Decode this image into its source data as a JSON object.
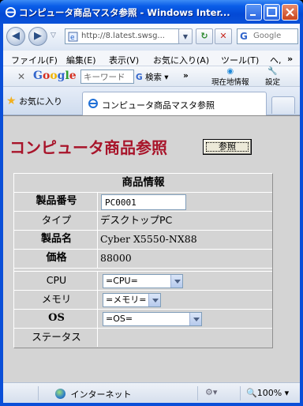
{
  "window": {
    "title": "コンピュータ商品マスタ参照 - Windows Inter..."
  },
  "address_bar": {
    "url": "http://8.latest.swsg...",
    "search_placeholder": "Google"
  },
  "menu": {
    "items": [
      "ファイル(F)",
      "編集(E)",
      "表示(V)",
      "お気に入り(A)",
      "ツール(T)",
      "ヘ,"
    ]
  },
  "google_toolbar": {
    "logo": "Google",
    "keyword_placeholder": "キーワード",
    "search_label": "検索",
    "location_label": "現在地情報",
    "settings_label": "設定"
  },
  "favorites": {
    "label": "お気に入り",
    "tab_title": "コンピュータ商品マスタ参照"
  },
  "page": {
    "title": "コンピュータ商品参照",
    "ref_button": "参照",
    "section_title": "商品情報",
    "fields": {
      "product_no_label": "製品番号",
      "product_no_value": "PC0001",
      "type_label": "タイプ",
      "type_value": "デスクトップPC",
      "name_label": "製品名",
      "name_value": "Cyber X5550-NX88",
      "price_label": "価格",
      "price_value": "88000",
      "cpu_label": "CPU",
      "cpu_value": "=CPU=",
      "memory_label": "メモリ",
      "memory_value": "=メモリ=",
      "os_label": "OS",
      "os_value": "=OS=",
      "status_label": "ステータス",
      "status_value": ""
    }
  },
  "status_bar": {
    "zone": "インターネット",
    "zoom": "100%"
  },
  "colors": {
    "title_red": "#a8142a",
    "xp_blue": "#0a4fd8",
    "page_gray": "#d4d4d4"
  }
}
